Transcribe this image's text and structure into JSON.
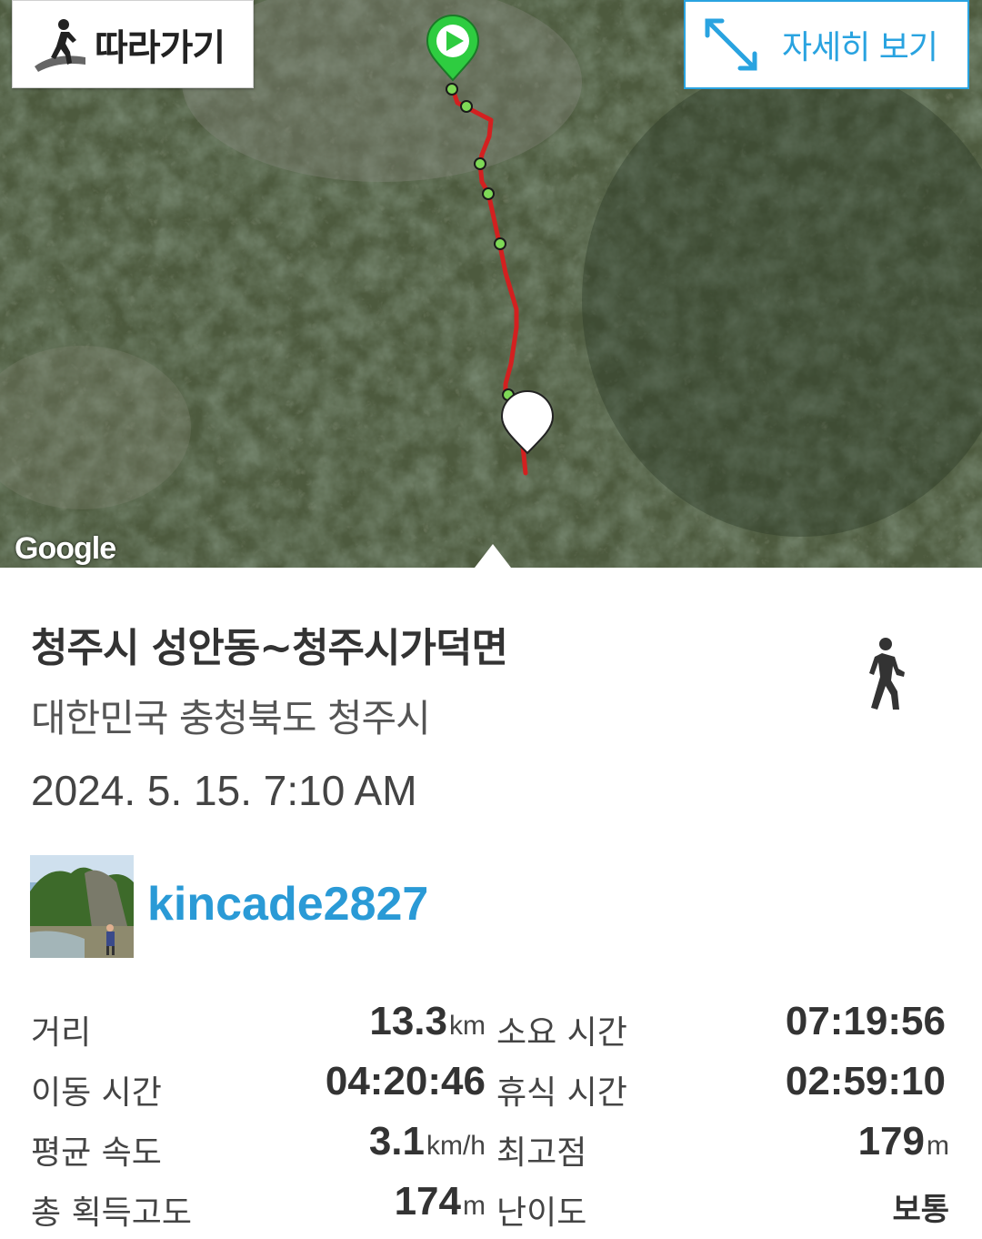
{
  "map": {
    "follow_label": "따라가기",
    "detail_label": "자세히 보기",
    "attribution": "Google",
    "route_color": "#d32020",
    "start_marker_color": "#2ecc40",
    "waypoint_color": "#7ed957"
  },
  "track": {
    "title": "청주시 성안동~청주시가덕면",
    "location": "대한민국 충청북도 청주시",
    "datetime": "2024. 5. 15. 7:10 AM",
    "username": "kincade2827",
    "activity_icon": "walking-icon"
  },
  "stats": {
    "distance": {
      "label": "거리",
      "value": "13.3",
      "unit": "km"
    },
    "total_time": {
      "label": "소요 시간",
      "value": "07:19:56"
    },
    "moving_time": {
      "label": "이동 시간",
      "value": "04:20:46"
    },
    "rest_time": {
      "label": "휴식 시간",
      "value": "02:59:10"
    },
    "avg_speed": {
      "label": "평균 속도",
      "value": "3.1",
      "unit": "km/h"
    },
    "max_elevation": {
      "label": "최고점",
      "value": "179",
      "unit": "m"
    },
    "total_ascent": {
      "label": "총 획득고도",
      "value": "174",
      "unit": "m"
    },
    "difficulty": {
      "label": "난이도",
      "value": "보통"
    }
  },
  "colors": {
    "accent": "#29a3e0",
    "username": "#2a9ad6"
  }
}
